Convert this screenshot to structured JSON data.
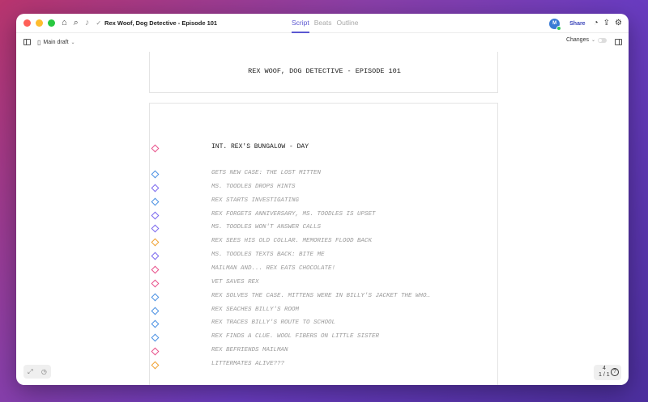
{
  "window": {
    "title": "Rex Woof, Dog Detective - Episode 101",
    "tabs": [
      {
        "label": "Script",
        "active": true
      },
      {
        "label": "Beats",
        "active": false
      },
      {
        "label": "Outline",
        "active": false
      }
    ],
    "share_label": "Share",
    "avatar_initial": "M",
    "traffic_colors": [
      "#ff5f57",
      "#febc2e",
      "#28c840"
    ]
  },
  "toolbar": {
    "draft_label": "Main draft",
    "changes_label": "Changes"
  },
  "script": {
    "title": "REX WOOF, DOG DETECTIVE - EPISODE 101",
    "scene_heading": "INT. REX'S BUNGALOW - DAY",
    "scene_icon_color": "#e8508a",
    "beats": [
      {
        "text": "GETS NEW CASE: THE LOST MITTEN",
        "color": "#4a90e2"
      },
      {
        "text": "MS. TOODLES DROPS HINTS",
        "color": "#7b68ee"
      },
      {
        "text": "REX STARTS INVESTIGATING",
        "color": "#4a90e2"
      },
      {
        "text": "REX FORGETS ANNIVERSARY, MS. TOODLES IS UPSET",
        "color": "#7b68ee"
      },
      {
        "text": "MS. TOODLES WON'T ANSWER CALLS",
        "color": "#7b68ee"
      },
      {
        "text": "REX SEES HIS OLD COLLAR. MEMORIES FLOOD BACK",
        "color": "#f0a030"
      },
      {
        "text": "MS. TOODLES TEXTS BACK: BITE ME",
        "color": "#7b68ee"
      },
      {
        "text": "MAILMAN AND... REX EATS CHOCOLATE!",
        "color": "#e8508a"
      },
      {
        "text": "VET SAVES REX",
        "color": "#e8508a"
      },
      {
        "text": "REX SOLVES THE CASE. MITTENS WERE IN BILLY'S JACKET THE WHO…",
        "color": "#4a90e2"
      },
      {
        "text": "REX SEACHES BILLY'S ROOM",
        "color": "#4a90e2"
      },
      {
        "text": "REX TRACES BILLY'S ROUTE TO SCHOOL",
        "color": "#4a90e2"
      },
      {
        "text": "REX FINDS A CLUE. WOOL FIBERS ON LITTLE SISTER",
        "color": "#4a90e2"
      },
      {
        "text": "REX BEFRIENDS MAILMAN",
        "color": "#e8508a"
      },
      {
        "text": "LITTERMATES ALIVE???",
        "color": "#f0a030"
      }
    ]
  },
  "footer": {
    "page_current": "4",
    "page_range": "1 / 1"
  }
}
